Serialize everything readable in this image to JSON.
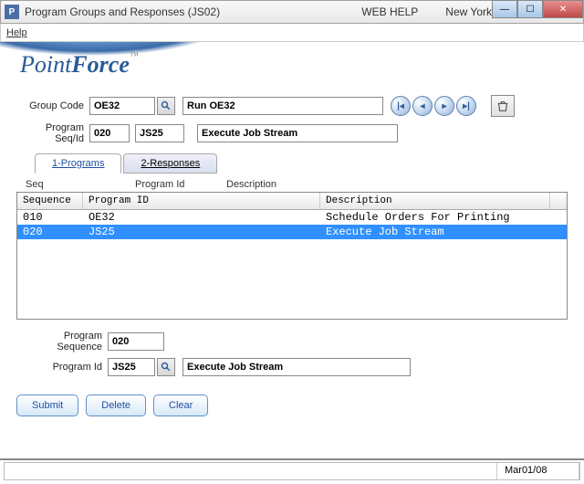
{
  "window": {
    "title": "Program Groups and Responses (JS02)",
    "web_help": "WEB HELP",
    "location": "New York",
    "app_icon_letter": "P"
  },
  "menu": {
    "help": "Help"
  },
  "logo": {
    "point": "Point",
    "force": "Force",
    "tm": "™"
  },
  "form": {
    "group_code_label": "Group Code",
    "group_code": "OE32",
    "group_desc": "Run OE32",
    "program_seq_label": "Program Seq/Id",
    "program_seq": "020",
    "program_id": "JS25",
    "program_desc": "Execute Job Stream"
  },
  "tabs": {
    "programs": "1-Programs",
    "responses": "2-Responses"
  },
  "col_hints": {
    "seq": "Seq",
    "program_id": "Program Id",
    "description": "Description"
  },
  "grid": {
    "headers": {
      "seq": "Sequence",
      "program_id": "Program ID",
      "description": "Description"
    },
    "rows": [
      {
        "seq": "010",
        "program_id": "OE32",
        "description": "Schedule Orders For Printing",
        "selected": false
      },
      {
        "seq": "020",
        "program_id": "JS25",
        "description": "Execute Job Stream",
        "selected": true
      }
    ]
  },
  "bottom": {
    "program_sequence_label": "Program Sequence",
    "program_sequence": "020",
    "program_id_label": "Program Id",
    "program_id": "JS25",
    "program_desc": "Execute Job Stream"
  },
  "actions": {
    "submit": "Submit",
    "delete": "Delete",
    "clear": "Clear"
  },
  "status": {
    "date": "Mar01/08"
  }
}
